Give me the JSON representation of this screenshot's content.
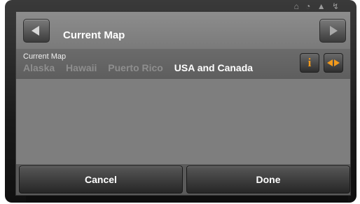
{
  "dialog": {
    "title": "Current Map",
    "row_label": "Current Map",
    "maps": [
      {
        "name": "Alaska",
        "selected": false
      },
      {
        "name": "Hawaii",
        "selected": false
      },
      {
        "name": "Puerto Rico",
        "selected": false
      },
      {
        "name": "USA and Canada",
        "selected": true
      }
    ],
    "info_icon": "i",
    "buttons": {
      "cancel": "Cancel",
      "done": "Done"
    }
  },
  "icons": {
    "back": "chevron-left-icon",
    "forward": "chevron-right-icon",
    "info": "info-icon",
    "swap": "swap-arrows-icon"
  },
  "colors": {
    "accent": "#f29a1c",
    "selected_text": "#ffffff",
    "unselected_text": "#8e8e8e"
  }
}
